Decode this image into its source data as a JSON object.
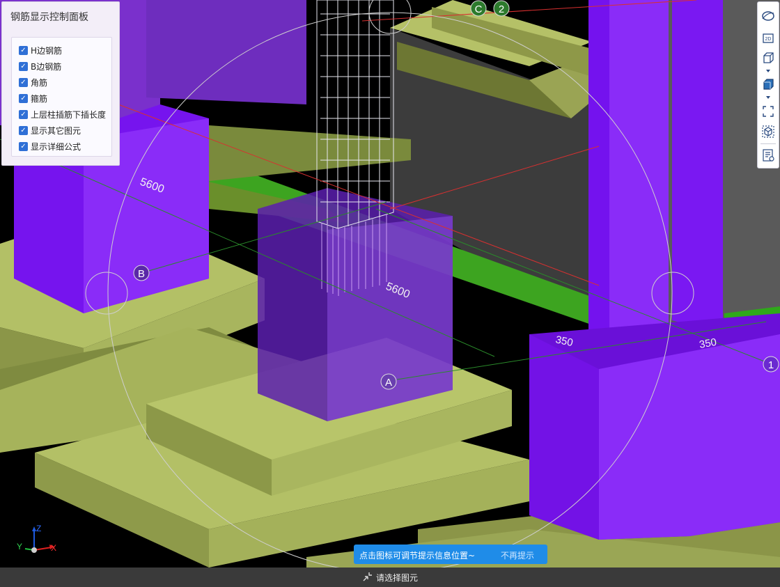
{
  "panel": {
    "title": "钢筋显示控制面板",
    "options": [
      {
        "label": "H边钢筋",
        "checked": true
      },
      {
        "label": "B边钢筋",
        "checked": true
      },
      {
        "label": "角筋",
        "checked": true
      },
      {
        "label": "箍筋",
        "checked": true
      },
      {
        "label": "上层柱插筋下插长度",
        "checked": true
      },
      {
        "label": "显示其它图元",
        "checked": true
      },
      {
        "label": "显示详细公式",
        "checked": true
      }
    ]
  },
  "scene": {
    "dimensions": [
      "5600",
      "5600",
      "350",
      "350"
    ],
    "axis_labels": [
      "C",
      "2",
      "B",
      "A",
      "1"
    ]
  },
  "toolbar": {
    "icons": [
      "orbit-icon",
      "view-2d-icon",
      "view-3d-icon",
      "box-view-icon",
      "fullscreen-icon",
      "isometric-cube-icon",
      "properties-icon"
    ]
  },
  "axes_gizmo": {
    "x": "X",
    "y": "Y",
    "z": "Z"
  },
  "tip": {
    "text": "点击图标可调节提示信息位置~",
    "dismiss": "不再提示"
  },
  "status": {
    "text": "请选择图元"
  },
  "colors": {
    "column": "#7a10f0",
    "footing": "#a5b25c",
    "beam_green": "#3ca21e",
    "tip_bg": "#1f8ce8",
    "checkbox": "#2f6fd6"
  }
}
